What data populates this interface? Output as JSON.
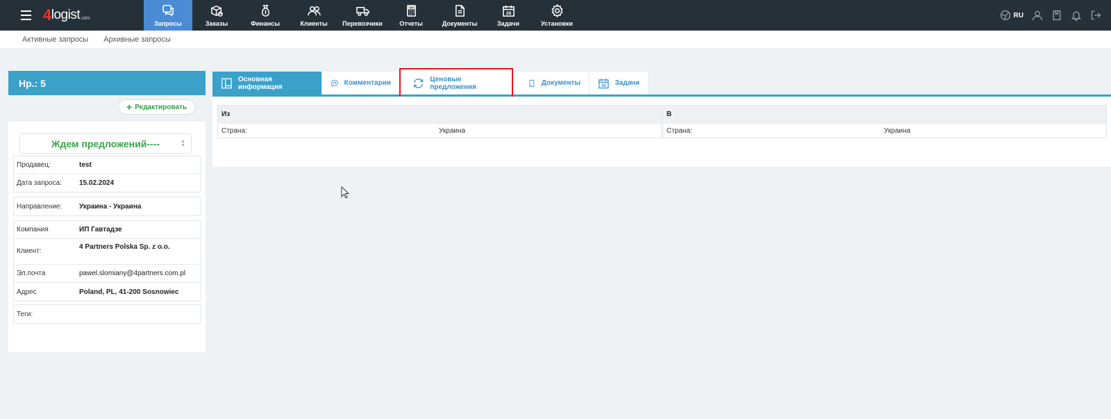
{
  "header": {
    "logo_number": "4",
    "logo_text": "logist",
    "logo_suffix": ".com",
    "nav": [
      {
        "label": "Запросы",
        "icon": "chat-question-icon"
      },
      {
        "label": "Заказы",
        "icon": "box-check-icon"
      },
      {
        "label": "Финансы",
        "icon": "money-bag-icon"
      },
      {
        "label": "Клиенты",
        "icon": "users-icon"
      },
      {
        "label": "Перевозчики",
        "icon": "truck-icon"
      },
      {
        "label": "Отчеты",
        "icon": "calculator-icon"
      },
      {
        "label": "Документы",
        "icon": "document-icon"
      },
      {
        "label": "Задачи",
        "icon": "calendar-icon"
      },
      {
        "label": "Установки",
        "icon": "gear-icon"
      }
    ],
    "language": "RU"
  },
  "subnav": {
    "items": [
      "Активные запросы",
      "Архивные запросы"
    ]
  },
  "request": {
    "title": "Нр.: 5",
    "edit_label": "Редактировать",
    "status": "Ждем предложений----",
    "fields": {
      "seller_label": "Продавец:",
      "seller_value": "test",
      "date_label": "Дата запроса:",
      "date_value": "15.02.2024",
      "direction_label": "Направление:",
      "direction_value": "Украина - Украина",
      "company_label": "Компания",
      "company_value": "ИП Гавтадзе",
      "client_label": "Клиент:",
      "client_value": "4 Partners Polska Sp. z o.o.",
      "email_label": "Эл.почта",
      "email_value": "pawel.slomiany@4partners.com.pl",
      "address_label": "Адрес",
      "address_value": "Poland, PL, 41-200 Sosnowiec",
      "tags_label": "Теги:",
      "tags_value": ""
    }
  },
  "tabs": [
    {
      "label": "Основная информация",
      "icon": "layout-icon"
    },
    {
      "label": "Комментарии",
      "icon": "comment-icon"
    },
    {
      "label": "Ценовые предложения",
      "icon": "refresh-icon"
    },
    {
      "label": "Документы",
      "icon": "document-icon"
    },
    {
      "label": "Задачи",
      "icon": "calendar-icon"
    }
  ],
  "route": {
    "from_header": "Из",
    "from_country_label": "Страна:",
    "from_country_value": "Украина",
    "to_header": "В",
    "to_country_label": "Страна:",
    "to_country_value": "Украина"
  },
  "colors": {
    "topbar": "#263038",
    "active_nav": "#4a8bd4",
    "accent": "#3ca1c9",
    "status_green": "#3aa44a",
    "highlight": "#e8141b"
  }
}
